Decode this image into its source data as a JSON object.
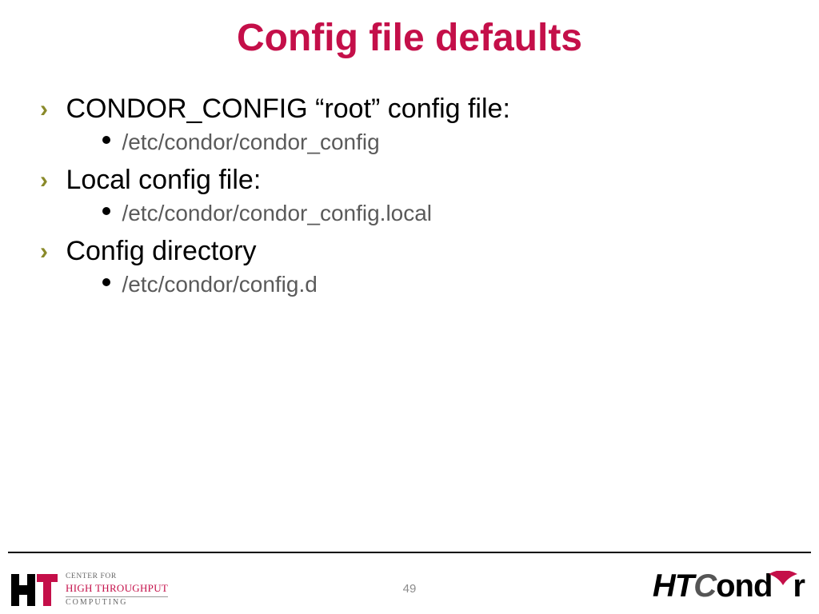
{
  "title": "Config file defaults",
  "bullets": {
    "b1": "CONDOR_CONFIG “root” config file:",
    "b1a": "/etc/condor/condor_config",
    "b2": "Local config file:",
    "b2a": "/etc/condor/condor_config.local",
    "b3": "Config directory",
    "b3a": "/etc/condor/config.d"
  },
  "page_number": "49",
  "logo_left": {
    "line1": "CENTER FOR",
    "line2": "HIGH THROUGHPUT",
    "line3": "COMPUTING"
  },
  "logo_right": {
    "ht": "HT",
    "c": "C",
    "ond": "ond",
    "r": "r"
  }
}
